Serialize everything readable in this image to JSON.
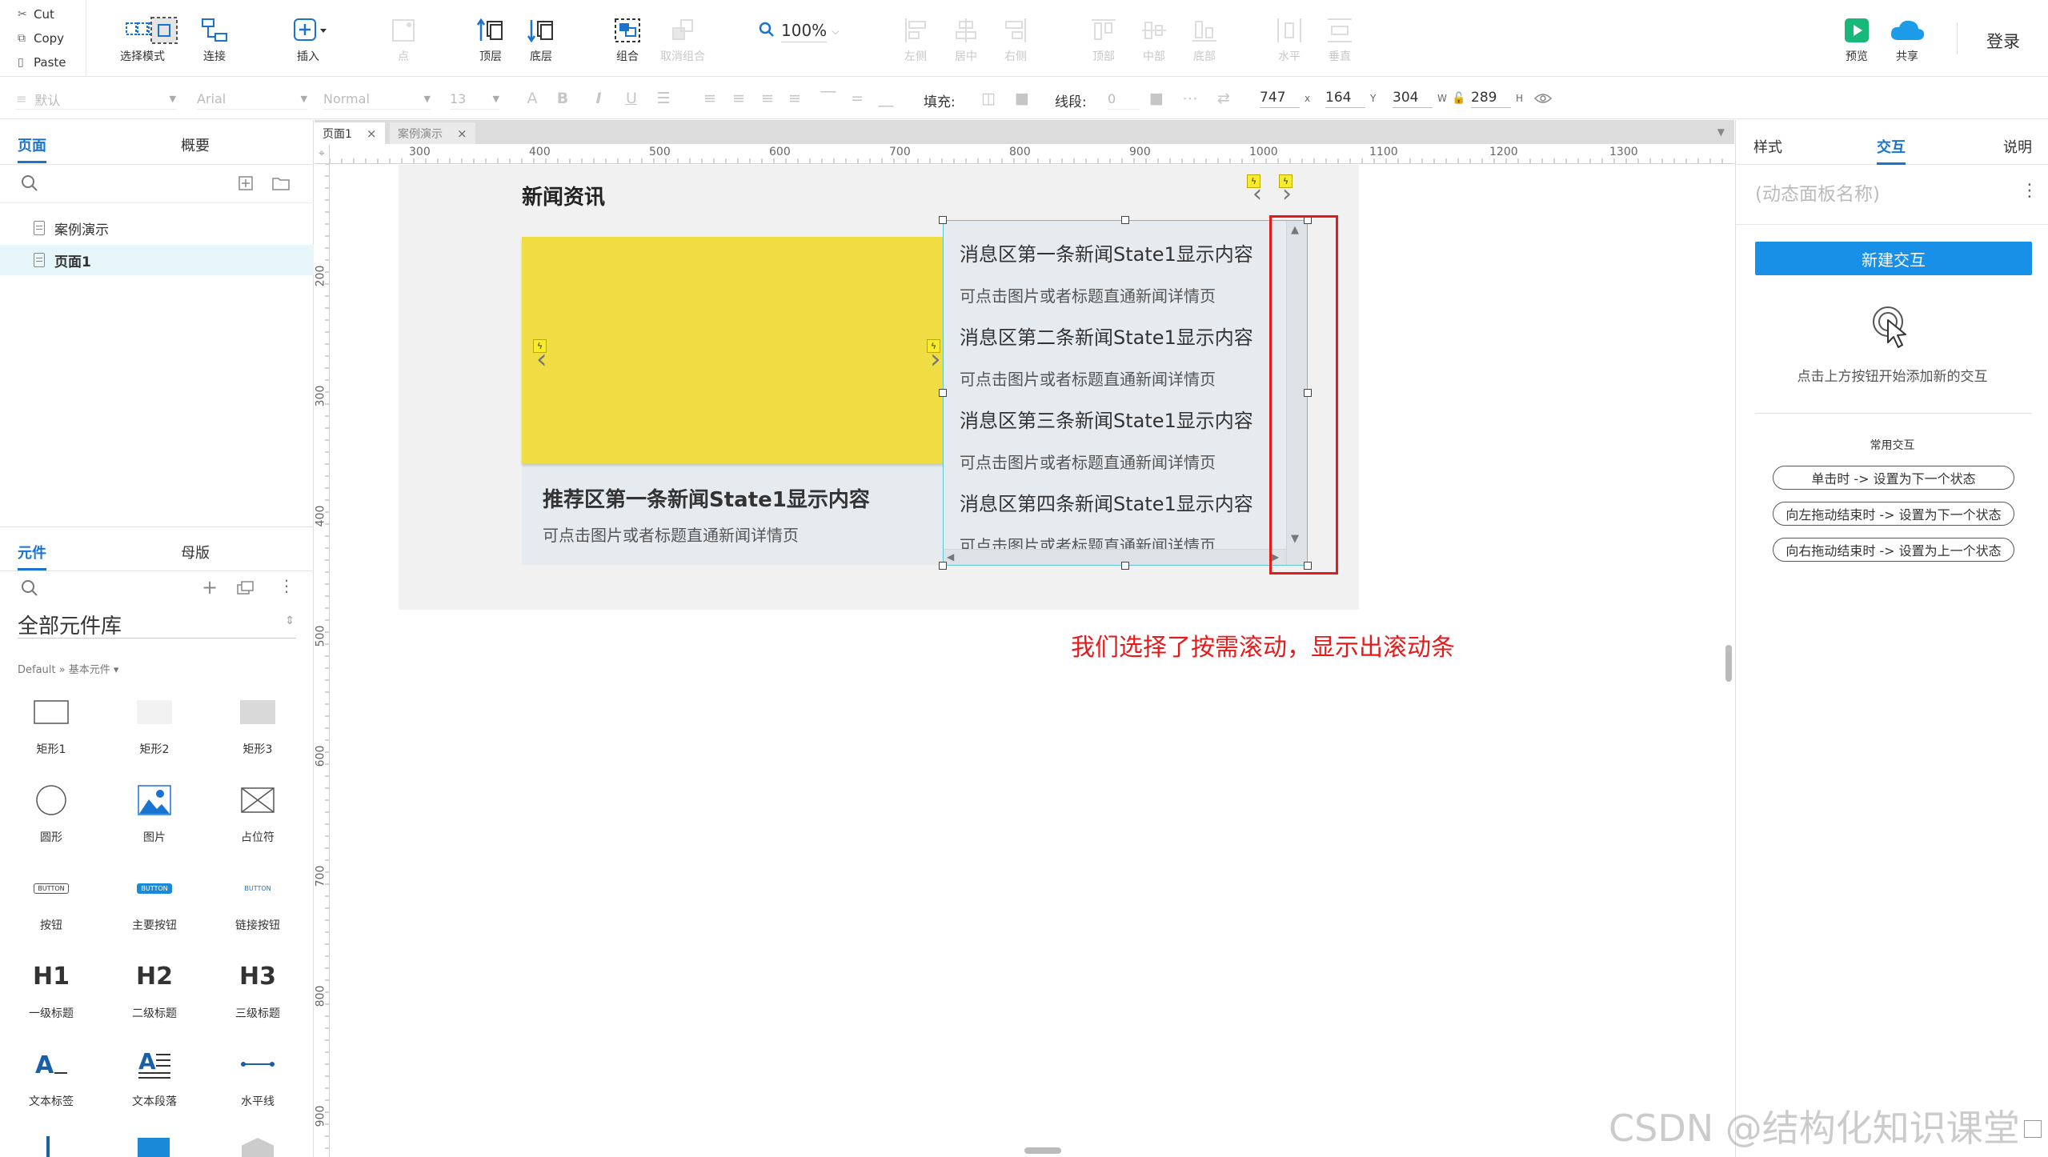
{
  "clipboard": {
    "cut": "Cut",
    "copy": "Copy",
    "paste": "Paste"
  },
  "toolbar": {
    "select_mode": "选择模式",
    "connect": "连接",
    "insert": "插入",
    "point": "点",
    "top_layer": "顶层",
    "bottom_layer": "底层",
    "group": "组合",
    "ungroup": "取消组合",
    "zoom": "100%",
    "align_left": "左侧",
    "align_center": "居中",
    "align_right": "右侧",
    "align_top": "顶部",
    "align_middle": "中部",
    "align_bottom": "底部",
    "dist_horizontal": "水平",
    "dist_vertical": "垂直",
    "preview": "预览",
    "share": "共享",
    "login": "登录"
  },
  "format": {
    "style": "默认",
    "font": "Arial",
    "weight": "Normal",
    "size": "13",
    "fill_label": "填充:",
    "line_label": "线段:",
    "line_value": "0",
    "x": "747",
    "x_unit": "x",
    "y": "164",
    "y_unit": "Y",
    "w": "304",
    "w_unit": "W",
    "h": "289",
    "h_unit": "H"
  },
  "left_panel": {
    "tabs": [
      "页面",
      "概要"
    ],
    "pages": [
      "案例演示",
      "页面1"
    ],
    "selected_page": "页面1",
    "comp_tabs": [
      "元件",
      "母版"
    ],
    "library_title": "全部元件库",
    "library_sub": "Default » 基本元件 ▾",
    "widgets": [
      "矩形1",
      "矩形2",
      "矩形3",
      "圆形",
      "图片",
      "占位符",
      "按钮",
      "主要按钮",
      "链接按钮",
      "一级标题",
      "二级标题",
      "三级标题",
      "文本标签",
      "文本段落",
      "水平线"
    ],
    "button_text": "BUTTON",
    "h1": "H1",
    "h2": "H2",
    "h3": "H3"
  },
  "doc_tabs": [
    {
      "label": "页面1",
      "active": true
    },
    {
      "label": "案例演示",
      "active": false
    }
  ],
  "rulers": {
    "h": [
      "300",
      "400",
      "500",
      "600",
      "700",
      "800",
      "900",
      "1000",
      "1100",
      "1200",
      "1300"
    ],
    "v": [
      "200",
      "300",
      "400",
      "500",
      "600",
      "700",
      "800",
      "900"
    ]
  },
  "canvas": {
    "title": "新闻资讯",
    "feature_title": "推荐区第一条新闻State1显示内容",
    "feature_desc": "可点击图片或者标题直通新闻详情页",
    "messages": [
      "消息区第一条新闻State1显示内容",
      "可点击图片或者标题直通新闻详情页",
      "消息区第二条新闻State1显示内容",
      "可点击图片或者标题直通新闻详情页",
      "消息区第三条新闻State1显示内容",
      "可点击图片或者标题直通新闻详情页",
      "消息区第四条新闻State1显示内容",
      "可点击图片或者标题直通新闻详情页"
    ],
    "annotation": "我们选择了按需滚动，显示出滚动条",
    "annotation_color": "#e51a1a",
    "watermark": "CSDN @结构化知识课堂"
  },
  "right_panel": {
    "tabs": [
      "样式",
      "交互",
      "说明"
    ],
    "active_tab": "交互",
    "panel_name": "(动态面板名称)",
    "new_interaction": "新建交互",
    "hint": "点击上方按钮开始添加新的交互",
    "common_title": "常用交互",
    "common": [
      "单击时 -> 设置为下一个状态",
      "向左拖动结束时 -> 设置为下一个状态",
      "向右拖动结束时 -> 设置为上一个状态"
    ],
    "accent": "#1890e8"
  }
}
